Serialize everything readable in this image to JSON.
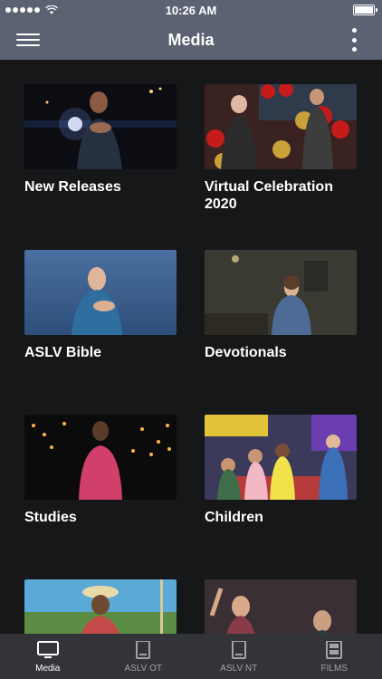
{
  "status": {
    "time": "10:26 AM"
  },
  "header": {
    "title": "Media"
  },
  "tiles": [
    {
      "label": "New Releases"
    },
    {
      "label": "Virtual Celebration 2020"
    },
    {
      "label": "ASLV Bible"
    },
    {
      "label": "Devotionals"
    },
    {
      "label": "Studies"
    },
    {
      "label": "Children"
    }
  ],
  "tabs": [
    {
      "label": "Media",
      "icon": "tv-icon",
      "active": true
    },
    {
      "label": "ASLV OT",
      "icon": "book-icon",
      "active": false
    },
    {
      "label": "ASLV NT",
      "icon": "book-icon",
      "active": false
    },
    {
      "label": "FILMS",
      "icon": "film-icon",
      "active": false
    }
  ],
  "colors": {
    "bar": "#5b6271",
    "background": "#161718",
    "tabbar": "#323438",
    "tab_active": "#ffffff",
    "tab_inactive": "#a1a3a7"
  }
}
